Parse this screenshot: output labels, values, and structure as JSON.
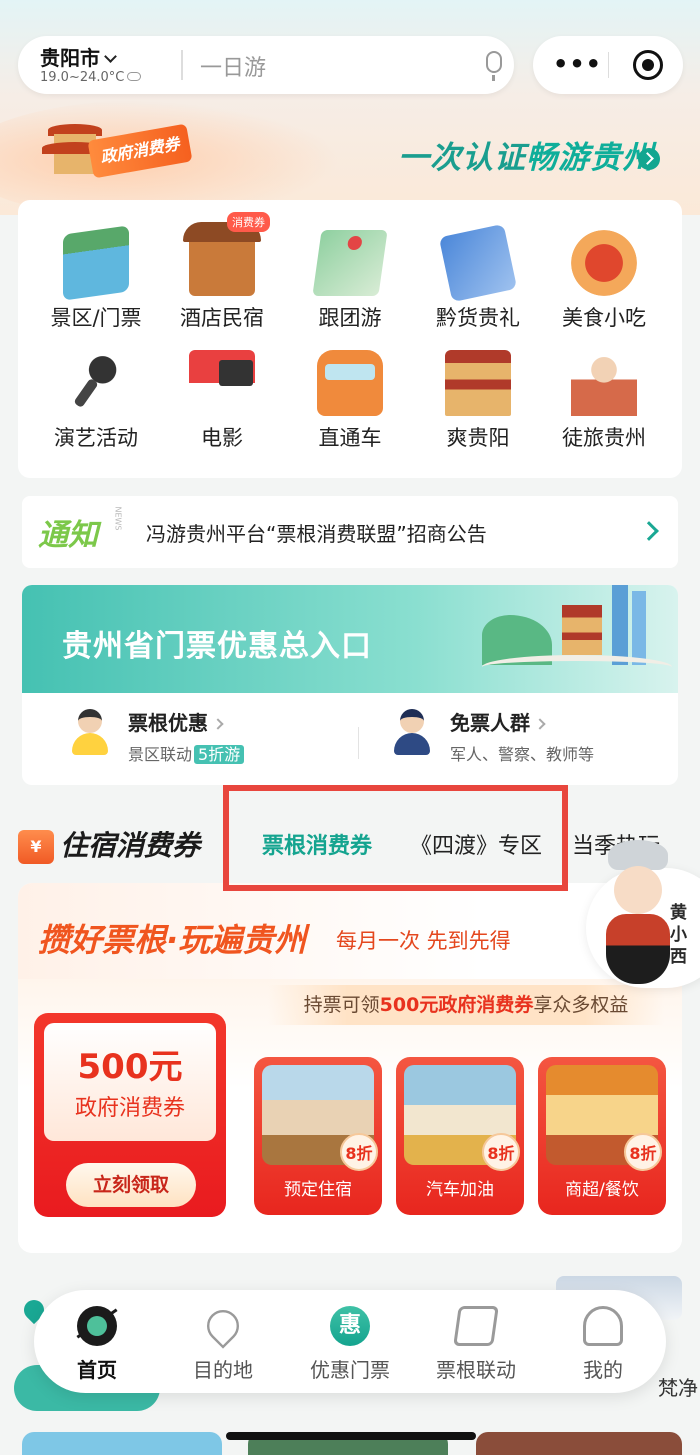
{
  "header": {
    "city": "贵阳市",
    "weather": "19.0~24.0°C",
    "search_placeholder": "一日游",
    "more_label": "•••"
  },
  "banner": {
    "badge": "政府消费券",
    "slogan_part1": "一次认证",
    "slogan_part2": "畅游贵州"
  },
  "categories": [
    {
      "label": "景区/门票",
      "icon": "waterfall-icon"
    },
    {
      "label": "酒店民宿",
      "icon": "hotel-icon",
      "badge": "消费券"
    },
    {
      "label": "跟团游",
      "icon": "map-icon"
    },
    {
      "label": "黔货贵礼",
      "icon": "gift-icon"
    },
    {
      "label": "美食小吃",
      "icon": "food-icon"
    },
    {
      "label": "演艺活动",
      "icon": "microphone-icon"
    },
    {
      "label": "电影",
      "icon": "movie-icon"
    },
    {
      "label": "直通车",
      "icon": "bus-icon"
    },
    {
      "label": "爽贵阳",
      "icon": "tower-icon"
    },
    {
      "label": "徒旅贵州",
      "icon": "traveler-icon"
    }
  ],
  "notice": {
    "tag": "通知",
    "tag_sub": "NEWS",
    "text": "冯游贵州平台“票根消费联盟”招商公告"
  },
  "ticket_entry": {
    "title": "贵州省门票优惠总入口",
    "left": {
      "title": "票根优惠",
      "desc": "景区联动",
      "pill": "5折游"
    },
    "right": {
      "title": "免票人群",
      "desc": "军人、警察、教师等"
    }
  },
  "tabs": {
    "hotel_icon": "¥",
    "hotel": "住宿消费券",
    "active": "票根消费券",
    "second": "《四渡》专区",
    "third": "当季热玩"
  },
  "promo": {
    "title": "攒好票根·玩遍贵州",
    "subtitle": "每月一次 先到先得",
    "benefit_prefix": "持票可领",
    "benefit_highlight": "500元政府消费券",
    "benefit_suffix": "享众多权益",
    "coupon_amount": "500元",
    "coupon_name": "政府消费券",
    "coupon_button": "立刻领取",
    "cards": [
      {
        "label": "预定住宿",
        "discount": "8折"
      },
      {
        "label": "汽车加油",
        "discount": "8折"
      },
      {
        "label": "商超/餐饮",
        "discount": "8折"
      }
    ]
  },
  "mascot": {
    "name": "黄小西"
  },
  "filter_peek": "梵净",
  "tabbar": [
    {
      "label": "首页",
      "icon": "home-icon",
      "active": true
    },
    {
      "label": "目的地",
      "icon": "location-icon",
      "active": false
    },
    {
      "label": "优惠门票",
      "icon": "discount-icon",
      "glyph": "惠",
      "active": false
    },
    {
      "label": "票根联动",
      "icon": "ticket-icon",
      "active": false
    },
    {
      "label": "我的",
      "icon": "user-icon",
      "active": false
    }
  ],
  "colors": {
    "accent": "#14a48f",
    "promo_red": "#e8321e",
    "highlight_box": "#e8463d"
  }
}
